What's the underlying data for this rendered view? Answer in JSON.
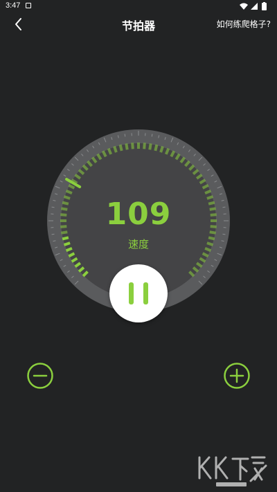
{
  "status_bar": {
    "time": "3:47"
  },
  "header": {
    "back_icon": "chevron-left-icon",
    "title": "节拍器",
    "help_link": "如何练爬格子?"
  },
  "metronome": {
    "bpm": "109",
    "bpm_label": "速度",
    "dial_fill_fraction": 0.0
  },
  "controls": {
    "pause_icon": "pause-icon",
    "minus_icon": "minus-icon",
    "plus_icon": "plus-icon"
  },
  "colors": {
    "background": "#222324",
    "accent": "#8bcf3e",
    "dial_face": "#444446",
    "dial_ring": "#5a5b5d"
  }
}
